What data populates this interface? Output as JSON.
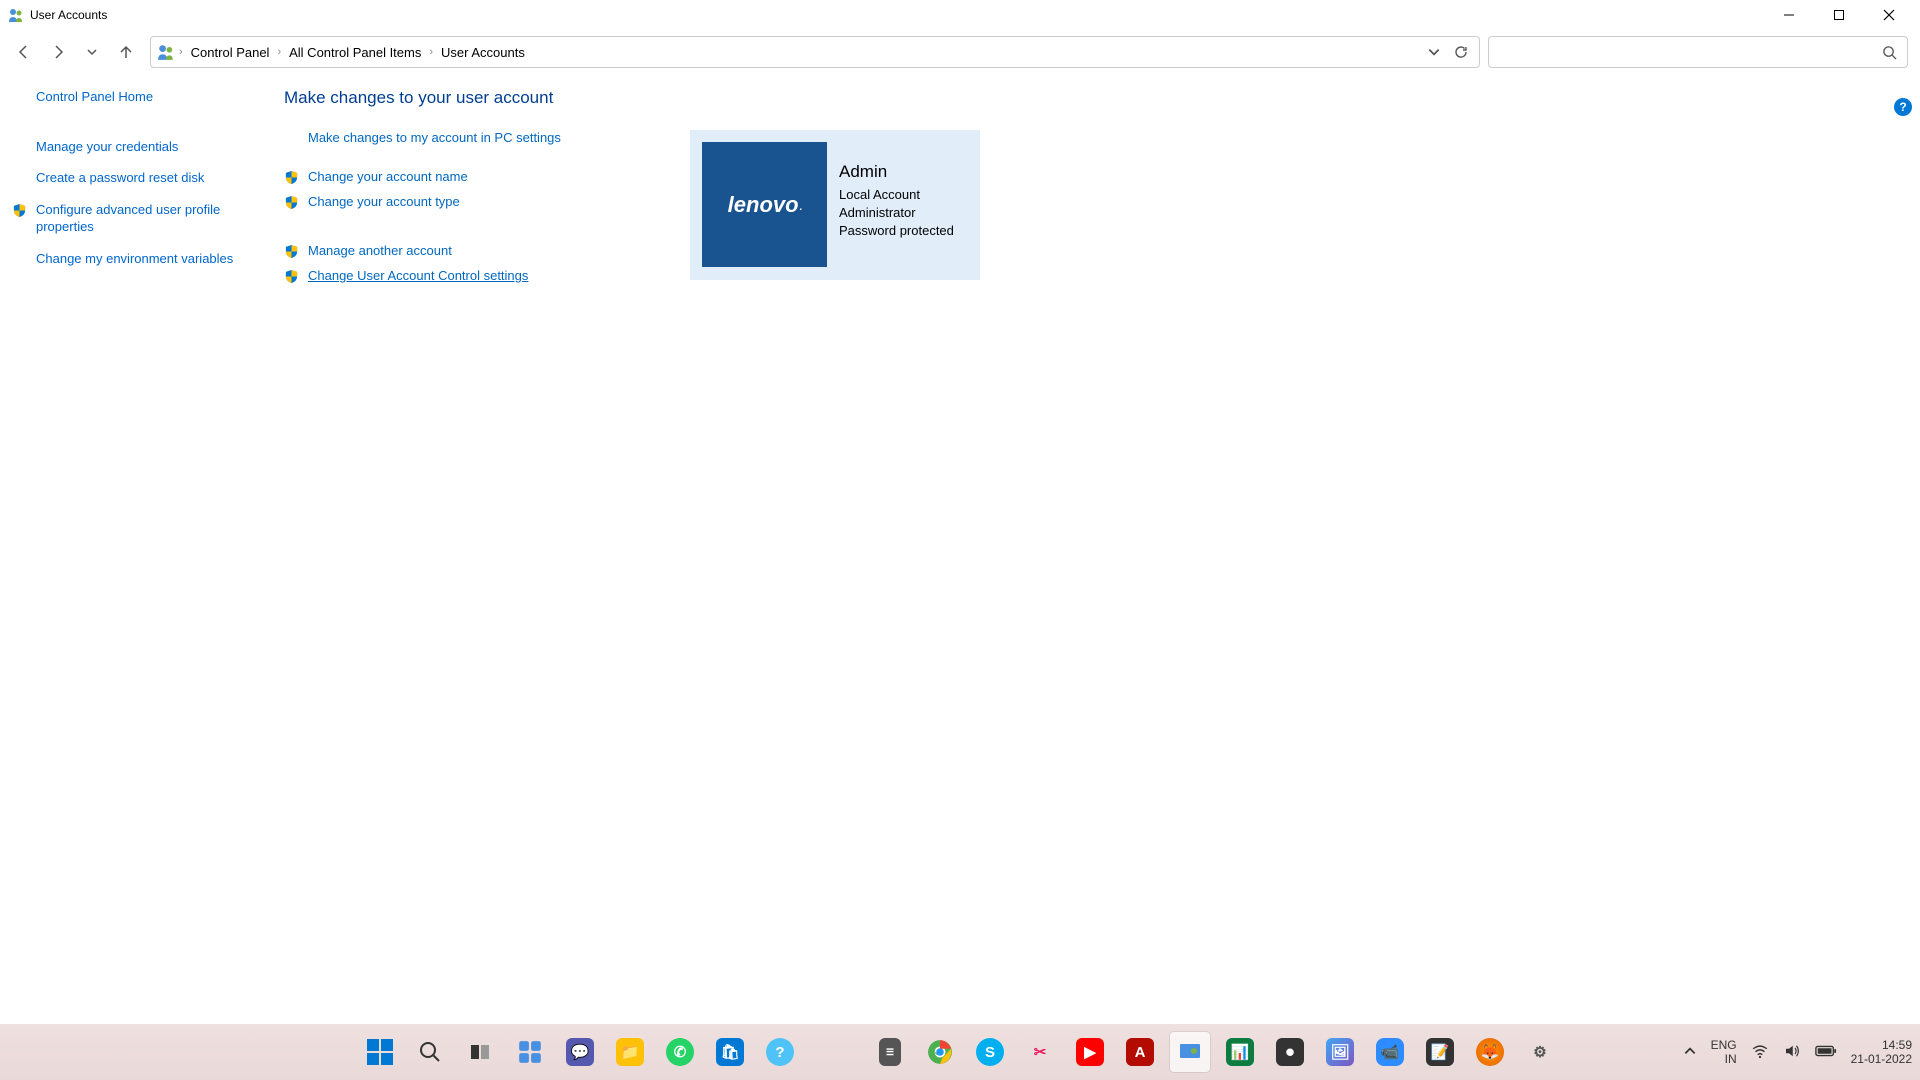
{
  "window": {
    "title": "User Accounts"
  },
  "breadcrumb": {
    "items": [
      "Control Panel",
      "All Control Panel Items",
      "User Accounts"
    ]
  },
  "help_tooltip": "?",
  "sidebar": {
    "items": [
      {
        "label": "Control Panel Home",
        "shield": false
      },
      {
        "label": "Manage your credentials",
        "shield": false
      },
      {
        "label": "Create a password reset disk",
        "shield": false
      },
      {
        "label": "Configure advanced user profile properties",
        "shield": true
      },
      {
        "label": "Change my environment variables",
        "shield": false
      }
    ]
  },
  "main": {
    "heading": "Make changes to your user account",
    "links_top": [
      {
        "label": "Make changes to my account in PC settings",
        "shield": false
      },
      {
        "label": "Change your account name",
        "shield": true
      },
      {
        "label": "Change your account type",
        "shield": true
      }
    ],
    "links_bottom": [
      {
        "label": "Manage another account",
        "shield": true,
        "underline": false
      },
      {
        "label": "Change User Account Control settings",
        "shield": true,
        "underline": true
      }
    ]
  },
  "profile": {
    "image_text": "lenovo",
    "name": "Admin",
    "account_type": "Local Account",
    "role": "Administrator",
    "protection": "Password protected"
  },
  "systray": {
    "lang1": "ENG",
    "lang2": "IN",
    "time": "14:59",
    "date": "21-01-2022"
  }
}
